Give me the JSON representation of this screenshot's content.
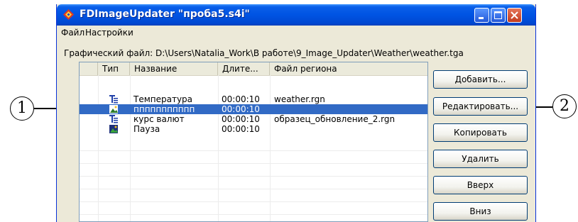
{
  "window": {
    "title": "FDImageUpdater \"проба5.s4i\""
  },
  "menu": [
    "Файл",
    "Настройки"
  ],
  "file_path": "Графический файл: D:\\Users\\Natalia_Work\\В работе\\9_Image_Updater\\Weather\\weather.tga",
  "table": {
    "columns": [
      "",
      "Тип",
      "Название",
      "Длите...",
      "Файл региона"
    ],
    "rows": [
      {
        "icon": "text-template-icon",
        "name": "Температура",
        "duration": "00:00:10",
        "region_file": "weather.rgn",
        "selected": false
      },
      {
        "icon": "image-template-icon",
        "name": "ппппппппппп",
        "duration": "00:00:10",
        "region_file": "",
        "selected": true
      },
      {
        "icon": "text-template-icon",
        "name": "курс валют",
        "duration": "00:00:10",
        "region_file": "образец_обновление_2.rgn",
        "selected": false
      },
      {
        "icon": "image-template-icon",
        "name": "Пауза",
        "duration": "00:00:10",
        "region_file": "",
        "selected": false
      }
    ]
  },
  "buttons": {
    "add": "Добавить...",
    "edit": "Редактировать...",
    "copy": "Копировать",
    "delete": "Удалить",
    "up": "Вверх",
    "down": "Вниз"
  },
  "callouts": {
    "one": "1",
    "two": "2"
  },
  "colors": {
    "selection": "#316ac5",
    "titlebar": "#0054e3",
    "close_button": "#c23b1e"
  }
}
